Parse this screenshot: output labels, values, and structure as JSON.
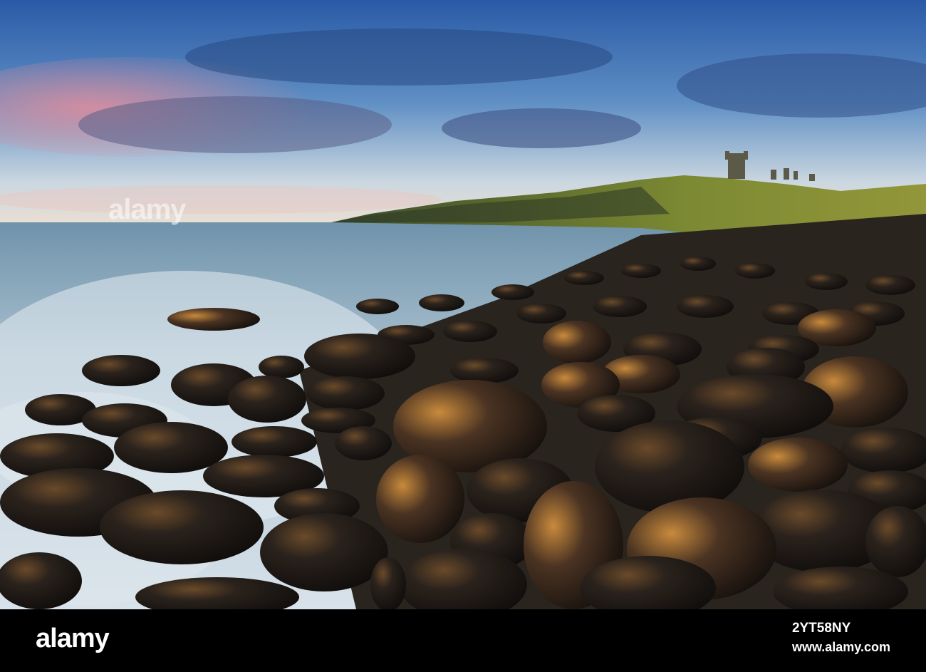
{
  "photo": {
    "description_colors": {
      "sky_top": "#2f5fa8",
      "sky_horizon": "#e8dccf",
      "sea": "#9fb8c8",
      "headland": "#6d7a2e",
      "boulders": "#1e1a17",
      "highlight": "#d08a3a"
    },
    "watermark_overlay_text": "alamy"
  },
  "footer": {
    "brand": "alamy",
    "image_id": "2YT58NY",
    "site": "www.alamy.com"
  }
}
